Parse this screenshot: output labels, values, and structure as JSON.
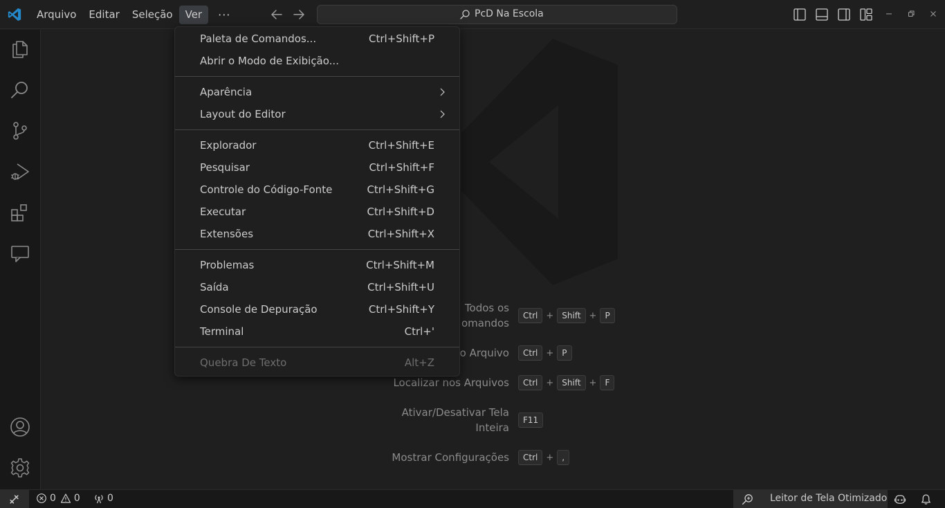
{
  "menubar": {
    "items": [
      "Arquivo",
      "Editar",
      "Seleção",
      "Ver"
    ],
    "more": "···",
    "active": "Ver"
  },
  "search": {
    "text": "PcD Na Escola"
  },
  "view_menu": {
    "group1": [
      {
        "label": "Paleta de Comandos...",
        "shortcut": "Ctrl+Shift+P"
      },
      {
        "label": "Abrir o Modo de Exibição...",
        "shortcut": ""
      }
    ],
    "group2": [
      {
        "label": "Aparência",
        "submenu": true
      },
      {
        "label": "Layout do Editor",
        "submenu": true
      }
    ],
    "group3": [
      {
        "label": "Explorador",
        "shortcut": "Ctrl+Shift+E"
      },
      {
        "label": "Pesquisar",
        "shortcut": "Ctrl+Shift+F"
      },
      {
        "label": "Controle do Código-Fonte",
        "shortcut": "Ctrl+Shift+G"
      },
      {
        "label": "Executar",
        "shortcut": "Ctrl+Shift+D"
      },
      {
        "label": "Extensões",
        "shortcut": "Ctrl+Shift+X"
      }
    ],
    "group4": [
      {
        "label": "Problemas",
        "shortcut": "Ctrl+Shift+M"
      },
      {
        "label": "Saída",
        "shortcut": "Ctrl+Shift+U"
      },
      {
        "label": "Console de Depuração",
        "shortcut": "Ctrl+Shift+Y"
      },
      {
        "label": "Terminal",
        "shortcut": "Ctrl+'"
      }
    ],
    "group5": [
      {
        "label": "Quebra De Texto",
        "shortcut": "Alt+Z",
        "disabled": true
      }
    ]
  },
  "editor_hints": {
    "show_all_commands": {
      "line1": "Todos os",
      "line2": "omandos",
      "keys": [
        "Ctrl",
        "Shift",
        "P"
      ]
    },
    "go_to_file": {
      "label": "o Arquivo",
      "keys": [
        "Ctrl",
        "P"
      ]
    },
    "find_in_files": {
      "label": "Localizar nos Arquivos",
      "keys": [
        "Ctrl",
        "Shift",
        "F"
      ]
    },
    "toggle_full_screen": {
      "line1": "Ativar/Desativar Tela",
      "line2": "Inteira",
      "keys": [
        "F11"
      ]
    },
    "show_settings": {
      "label": "Mostrar Configurações",
      "keys": [
        "Ctrl",
        ","
      ]
    },
    "plus": "+"
  },
  "statusbar": {
    "errors": "0",
    "warnings": "0",
    "ports": "0",
    "screen_reader": "Leitor de Tela Otimizado"
  },
  "colors": {
    "background": "#1f1f1f",
    "accent": "#0078d4",
    "menu_active": "#3a3d41"
  }
}
